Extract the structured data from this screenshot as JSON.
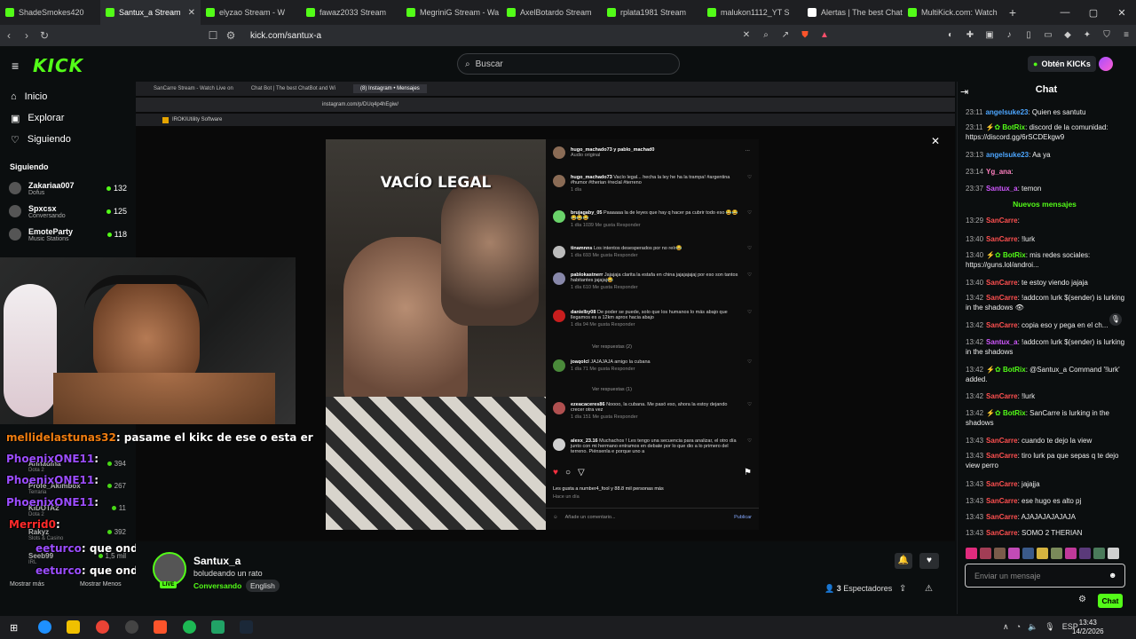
{
  "browser": {
    "tabs": [
      {
        "label": "ShadeSmokes420",
        "color": "#53fc18"
      },
      {
        "label": "Santux_a Stream",
        "color": "#53fc18",
        "active": true
      },
      {
        "label": "elyzao Stream - W",
        "color": "#53fc18"
      },
      {
        "label": "fawaz2033 Stream",
        "color": "#53fc18"
      },
      {
        "label": "MegriniG Stream - Wa",
        "color": "#53fc18"
      },
      {
        "label": "AxelBotardo Stream",
        "color": "#53fc18"
      },
      {
        "label": "rplata1981 Stream",
        "color": "#53fc18"
      },
      {
        "label": "malukon1112_YT S",
        "color": "#53fc18"
      },
      {
        "label": "Alertas | The best Chat",
        "color": "#ffffff"
      },
      {
        "label": "MultiKick.com: Watch",
        "color": "#53fc18"
      }
    ],
    "url": "kick.com/santux-a"
  },
  "header": {
    "logo": "KICK",
    "search_placeholder": "Buscar",
    "get_kicks": "Obtén KICKs"
  },
  "sidebar": {
    "nav": [
      {
        "label": "Inicio",
        "icon": "home-icon"
      },
      {
        "label": "Explorar",
        "icon": "compass-icon"
      },
      {
        "label": "Siguiendo",
        "icon": "heart-icon"
      }
    ],
    "following_title": "Siguiendo",
    "following": [
      {
        "name": "Zakariaa007",
        "sub": "Dofus",
        "count": "132"
      },
      {
        "name": "Spxcsx",
        "sub": "Conversando",
        "count": "125"
      },
      {
        "name": "EmoteParty",
        "sub": "Music Stations",
        "count": "118"
      }
    ],
    "overlay_following": [
      {
        "name": "Annadina",
        "sub": "Dota 2",
        "count": "394"
      },
      {
        "name": "Profe_Akimbox",
        "sub": "Terraria",
        "count": "267"
      },
      {
        "name": "KIDOTA2",
        "sub": "Dota 2",
        "count": "11"
      },
      {
        "name": "Rakyz",
        "sub": "Slots & Casino",
        "count": "392"
      },
      {
        "name": "Seeb99",
        "sub": "IRL",
        "count": "1,5 mil"
      }
    ],
    "show_more": "Mostrar más",
    "show_less": "Mostrar Menos"
  },
  "inner_browser": {
    "tabs": [
      "SanCarre Stream - Watch Live on",
      "Chat Bot | The best ChatBot and Wi",
      "(8) Instagram • Mensajes"
    ],
    "url": "instagram.com/p/DUq4p4hEgiw/",
    "bookmark": "IROKIUtility Software"
  },
  "video": {
    "caption": "VACÍO LEGAL"
  },
  "ig_post": {
    "header_user": "hugo_machado73 y pablo_machad0",
    "header_sub": "Audio original",
    "comments": [
      {
        "user": "hugo_machado73",
        "text": "Vacío legal... hecha la ley he ha la trampa! #argentina #humor #therian #reclal #terreno",
        "meta": "1 día"
      },
      {
        "user": "brujagaby_05",
        "text": "Paaaaaa la de leyes que hay q hacer pa cubrir todo eso 😂😂😂😂😂",
        "meta": "1 día   1039 Me gusta   Responder"
      },
      {
        "user": "tinamnns",
        "text": "Los intentos desesperados por no reír😂",
        "meta": "1 día   693 Me gusta   Responder"
      },
      {
        "user": "pablokastnerr",
        "text": "Jajajaja clarita la estafa en china jajajajajaj por eso son tantos habitantes jajajaj😂",
        "meta": "1 día   610 Me gusta   Responder"
      },
      {
        "user": "danielby08",
        "text": "De poder se puede, solo que los humanos lo más abajo que llegamos es a 12km aprox hacia abajo",
        "meta": "1 día   94 Me gusta   Responder"
      },
      {
        "user": "joaqolcl",
        "text": "JAJAJAJA amigo la cubana",
        "meta": "1 día   71 Me gusta   Responder"
      },
      {
        "user": "ezeacaceres86",
        "text": "Noooo, la cubana. Me pasó eso, ahora la estoy dejando crecer otra vez",
        "meta": "1 día   151 Me gusta   Responder"
      },
      {
        "user": "alexx_23.16",
        "text": "Muchachos ! Les tengo una secuencia para analizar, el otro día junto con mi hermano entramos en debate por lo que dio a lo primero del terreno. Piénsenla e porque uno a",
        "meta": ""
      }
    ],
    "view_replies_1": "Ver respuestas (2)",
    "view_replies_2": "Ver respuestas (1)",
    "likes": "Les gusta a number4_fool y 88.8 mil personas más",
    "likes_sub": "Hace un día",
    "add_comment": "Añade un comentario...",
    "publish": "Publicar"
  },
  "overlay_chat": [
    {
      "user": "mellidelastunas32",
      "text": ": pasame el kikc de ese o esta er",
      "color": "#f07d10"
    },
    {
      "user": "PhoenixONE11",
      "text": ":",
      "color": "#9b4dff"
    },
    {
      "user": "PhoenixONE11",
      "text": ":",
      "color": "#9b4dff"
    },
    {
      "user": "PhoenixONE11",
      "text": ":",
      "color": "#9b4dff"
    },
    {
      "user": "Merrid0",
      "text": ":",
      "color": "#ff2a2a"
    },
    {
      "user": "eeturco",
      "text": ": que onda mano",
      "color": "#9b4dff"
    },
    {
      "user": "eeturco",
      "text": ": que onda mano",
      "color": "#9b4dff"
    }
  ],
  "streamer": {
    "name": "Santux_a",
    "title": "boludeando un rato",
    "category": "Conversando",
    "language": "English",
    "live": "LIVE",
    "viewers": "3",
    "viewers_label": "Espectadores"
  },
  "chat": {
    "title": "Chat",
    "new_messages": "Nuevos mensajes",
    "messages": [
      {
        "time": "23:11",
        "user": "angelsuke23",
        "color": "#4da6ff",
        "text": ": Quien es santutu"
      },
      {
        "time": "23:11",
        "user": "BotRix",
        "color": "#53fc18",
        "text": ": discord de la comunidad: https://discord.gg/6rSCDEkgw9",
        "bot": true
      },
      {
        "time": "23:13",
        "user": "angelsuke23",
        "color": "#4da6ff",
        "text": ": Aa ya"
      },
      {
        "time": "23:14",
        "user": "Yg_ana",
        "color": "#ff7fbf",
        "text": ":"
      },
      {
        "time": "23:37",
        "user": "Santux_a",
        "color": "#d158ff",
        "text": ": temon"
      },
      {
        "time": "13:29",
        "user": "SanCarre",
        "color": "#ff5050",
        "text": ":"
      },
      {
        "time": "13:40",
        "user": "SanCarre",
        "color": "#ff5050",
        "text": ": !lurk"
      },
      {
        "time": "13:40",
        "user": "BotRix",
        "color": "#53fc18",
        "text": ": mis redes sociales: https://guns.lol/androi...",
        "bot": true
      },
      {
        "time": "13:40",
        "user": "SanCarre",
        "color": "#ff5050",
        "text": ": te estoy viendo jajaja"
      },
      {
        "time": "13:42",
        "user": "SanCarre",
        "color": "#ff5050",
        "text": ": !addcom lurk $(sender) is lurking in the shadows 👁"
      },
      {
        "time": "13:42",
        "user": "SanCarre",
        "color": "#ff5050",
        "text": ": copia eso y pega en el ch..."
      },
      {
        "time": "13:42",
        "user": "Santux_a",
        "color": "#d158ff",
        "text": ": !addcom lurk $(sender) is lurking in the shadows"
      },
      {
        "time": "13:42",
        "user": "BotRix",
        "color": "#53fc18",
        "text": ": @Santux_a Command '!lurk' added.",
        "bot": true
      },
      {
        "time": "13:42",
        "user": "SanCarre",
        "color": "#ff5050",
        "text": ": !lurk"
      },
      {
        "time": "13:42",
        "user": "BotRix",
        "color": "#53fc18",
        "text": ": SanCarre is lurking in the shadows",
        "bot": true
      },
      {
        "time": "13:43",
        "user": "SanCarre",
        "color": "#ff5050",
        "text": ": cuando te dejo la view"
      },
      {
        "time": "13:43",
        "user": "SanCarre",
        "color": "#ff5050",
        "text": ": tiro lurk pa que sepas q te dejo view perro"
      },
      {
        "time": "13:43",
        "user": "SanCarre",
        "color": "#ff5050",
        "text": ": jajajja"
      },
      {
        "time": "13:43",
        "user": "SanCarre",
        "color": "#ff5050",
        "text": ": ese hugo es alto pj"
      },
      {
        "time": "13:43",
        "user": "SanCarre",
        "color": "#ff5050",
        "text": ": AJAJAJAJAJAJA"
      },
      {
        "time": "13:43",
        "user": "SanCarre",
        "color": "#ff5050",
        "text": ": SOMO 2 THERIAN"
      }
    ],
    "input_placeholder": "Enviar un mensaje",
    "send": "Chat"
  },
  "taskbar": {
    "lang": "ESP",
    "time": "13:43",
    "date": "14/2/2026"
  }
}
